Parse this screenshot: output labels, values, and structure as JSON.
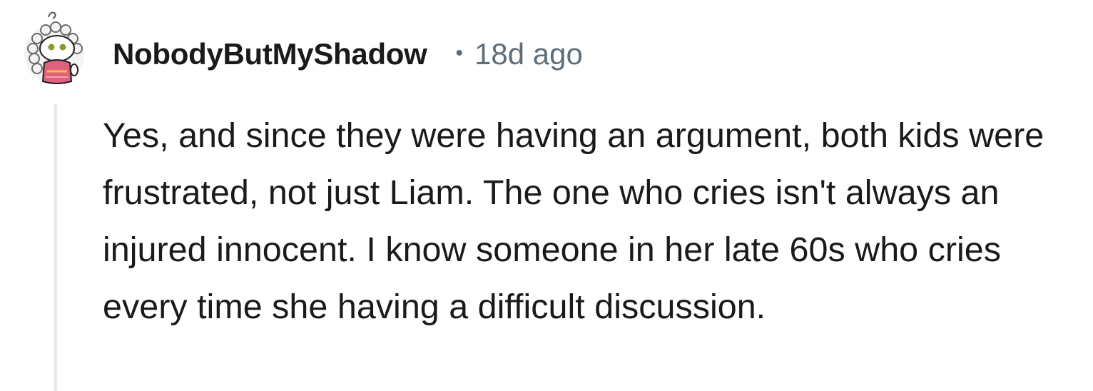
{
  "comment": {
    "username": "NobodyButMyShadow",
    "separator": "•",
    "timestamp": "18d ago",
    "body": "Yes, and since they were having an argument, both kids were frustrated, not just Liam. The one who cries isn't always an injured innocent. I know someone in her late 60s who cries every time she having a difficult discussion."
  },
  "colors": {
    "text": "#1a1a1b",
    "meta": "#5f6e79",
    "thread_line": "#e6e8ea"
  },
  "icons": {
    "avatar": "reddit-snoo-avatar-icon"
  }
}
